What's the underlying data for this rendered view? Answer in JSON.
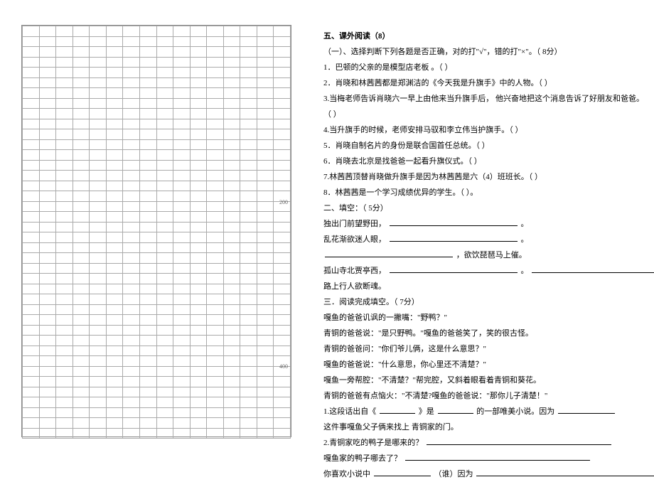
{
  "left": {
    "marker200": "200",
    "marker400": "400"
  },
  "right": {
    "section_title": "五、课外阅读（8）",
    "part1_instruction": "（一）、选择判断下列各题是否正确，对的打\"√\"，错的打\"×\"。（ 8分）",
    "q1": "1．巴顿的父亲的是模型店老板  。（            ）",
    "q2": "2．肖晓和林茜茜都是郑渊洁的《今天我是升旗手》中的人物。（            ）",
    "q3": "3.当梅老师告诉肖晓六一早上由他来当升旗手后， 他兴奋地把这个消息告诉了好朋友和爸爸。",
    "q3b": "（         ）",
    "q4": "4.当升旗手的时候，老师安排马驭和李立伟当护旗手。（          ）",
    "q5": "5．肖晓自制名片的身份是联合国首任总统。（         ）",
    "q6": "6．肖晓去北京是找爸爸一起看升旗仪式。（            ）",
    "q7": "7.林茜茜顶替肖晓做升旗手是因为林茜茜是六（4）班班长。（       ）",
    "q8": "8．林茜茜是一个学习成绩优异的学生。（           ）。",
    "part2_title": "二、填空：（ 5分）",
    "p2l1a": "独出门前望野田，",
    "p2l1b": "。",
    "p2l2a": "乱花渐欲迷人眼，",
    "p2l2b": "。",
    "p2l3a": "，欲饮琵琶马上催。",
    "p2l4a": "孤山寺北贾亭西，",
    "p2l4b": "。",
    "p2l5a": "路上行人欲断魂。",
    "part3_title": "三．阅读完成填空。（ 7分）",
    "p3l1": "嘎鱼的爸爸讥讽的一撇嘴：\"野鸭？\"",
    "p3l2": "青铜的爸爸说：\"是只野鸭。\"嘎鱼的爸爸笑了，笑的很古怪。",
    "p3l3": "青铜的爸爸问：\"你们爷儿俩，这是什么意思？\"",
    "p3l4": "嘎鱼的爸爸说：\"什么意思，你心里还不清楚？\"",
    "p3l5": "嘎鱼一旁帮腔：\"不清楚？\"帮完腔，又斜着眼看着青铜和葵花。",
    "p3l6": "青铜的爸爸有点恼火：\"不清楚?嘎鱼的爸爸说：\"那你儿子清楚！\"",
    "p3q1a": "1.这段话出自《",
    "p3q1b": "》是",
    "p3q1c": "的一部唯美小说。因为",
    "p3q2a": "这件事嘎鱼父子俩来找上  青铜家的门。",
    "p3q3a": "2.青铜家吃的鸭子是哪来的？",
    "p3q4a": "嘎鱼家的鸭子哪去了？",
    "p3q5a": "你喜欢小说中",
    "p3q5b": "（谁）因为"
  }
}
